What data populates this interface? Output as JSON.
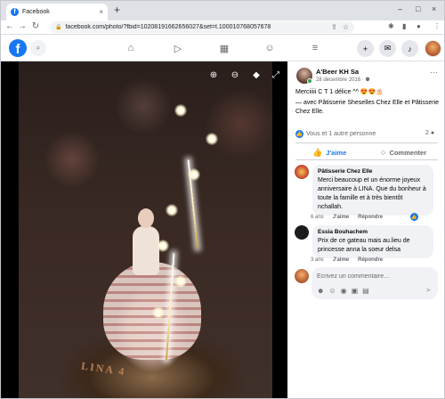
{
  "browser": {
    "tab_title": "Facebook",
    "tab_close": "×",
    "new_tab": "+",
    "url": "facebook.com/photo/?fbid=10208191662656027&set=t.100010768057678",
    "window_controls": [
      "–",
      "□",
      "×"
    ]
  },
  "fb_nav": {
    "logo_letter": "f",
    "icons": [
      "home-icon",
      "watch-icon",
      "marketplace-icon",
      "groups-icon",
      "menu-icon"
    ],
    "right_icons": [
      "create-icon",
      "messenger-icon",
      "notifications-icon",
      "account-icon"
    ]
  },
  "post": {
    "author": "A'Beer KH Sa",
    "date": "28 décembre 2016 · ",
    "text": "Merciiiii C T 1 délice ^^ 😍😍🎂",
    "with_text": "— avec Pâtisserie Sheselles Chez Elle et Pâtisserie Chez Elle.",
    "reactions_text": "Vous et 1 autre personne",
    "comment_count": "2",
    "like_label": "J'aime",
    "comment_label": "Commenter"
  },
  "photo": {
    "cake_text": "LINA 4"
  },
  "comments": [
    {
      "name": "Pâtisserie Chez Elle",
      "text": "Merci beaucoup et un énorme joyeux anniversaire à LINA. Que du bonheur à toute la famille et à très bientôt nchallah.",
      "time": "6 ans",
      "like": "J'aime",
      "reply": "Répondre"
    },
    {
      "name": "Essia Bouhachem",
      "text": "Prix de ce gateau mais au.lieu de princesse anna la soeur delsa",
      "time": "3 ans",
      "like": "J'aime",
      "reply": "Répondre"
    }
  ],
  "composer": {
    "placeholder": "Écrivez un commentaire…"
  },
  "colors": {
    "facebook_blue": "#1877f2",
    "online_green": "#31a24c"
  }
}
